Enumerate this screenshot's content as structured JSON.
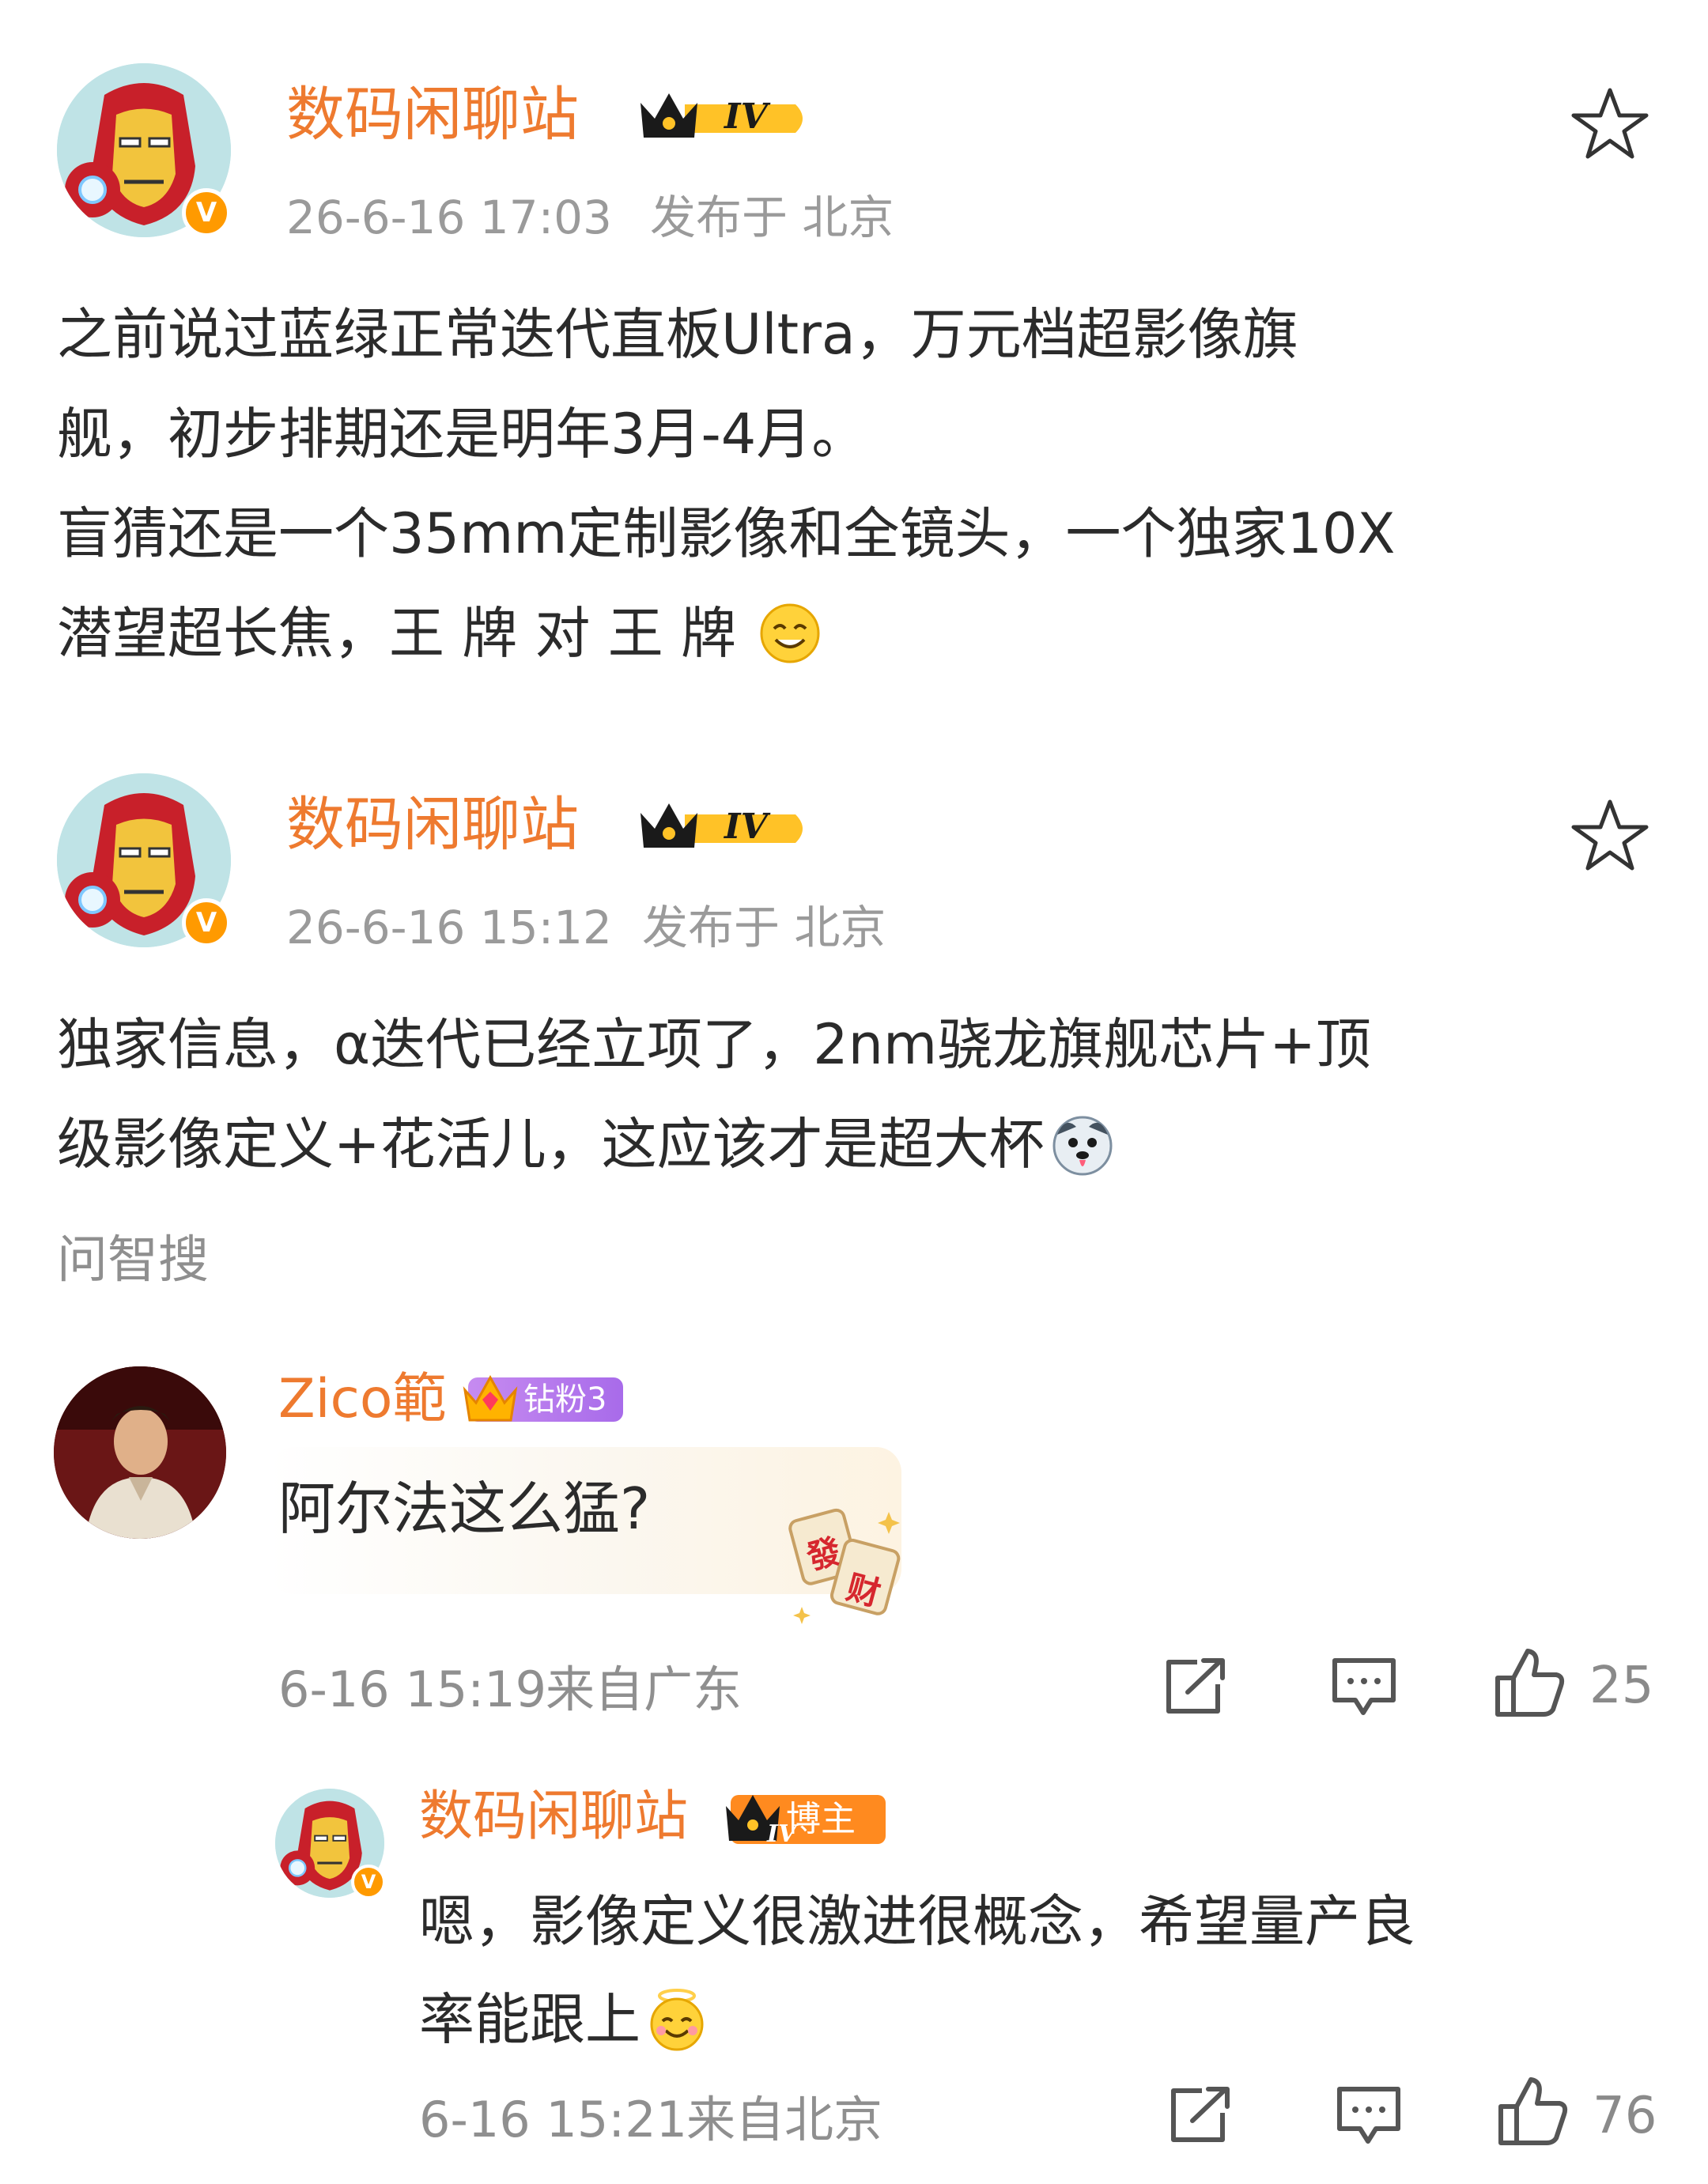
{
  "posts": [
    {
      "author": "数码闲聊站",
      "level_badge": "IV",
      "time": "26-6-16 17:03",
      "location": "发布于 北京",
      "lines": [
        "之前说过蓝绿正常迭代直板Ultra，万元档超影像旗",
        "舰，初步排期还是明年3月-4月。",
        "盲猜还是一个35mm定制影像和全镜头，一个独家10X",
        "潜望超长焦，王 牌 对 王 牌"
      ],
      "emoji_icon": "smile-emoji-icon"
    },
    {
      "author": "数码闲聊站",
      "level_badge": "IV",
      "time": "26-6-16 15:12",
      "location": "发布于 北京",
      "lines": [
        "独家信息，α迭代已经立项了，2nm骁龙旗舰芯片+顶",
        "级影像定义+花活儿，这应该才是超大杯"
      ],
      "emoji_icon": "husky-emoji-icon"
    }
  ],
  "ask_search": "问智搜",
  "comment": {
    "author": "Zico範",
    "fan_badge": "钻粉3",
    "text": "阿尔法这么猛?",
    "sticker_chars": [
      "發",
      "财"
    ],
    "time": "6-16 15:19",
    "location": "来自广东",
    "likes": "25"
  },
  "reply": {
    "author": "数码闲聊站",
    "host_badge": "博主",
    "level_badge": "IV",
    "lines": [
      "嗯，影像定义很激进很概念，希望量产良",
      "率能跟上"
    ],
    "time": "6-16 15:21",
    "location": "来自北京",
    "likes": "76"
  },
  "colors": {
    "name": "#ee7a2f",
    "meta": "#9a9a9a",
    "text": "#2b2b2b",
    "verified": "#ff9a00"
  }
}
